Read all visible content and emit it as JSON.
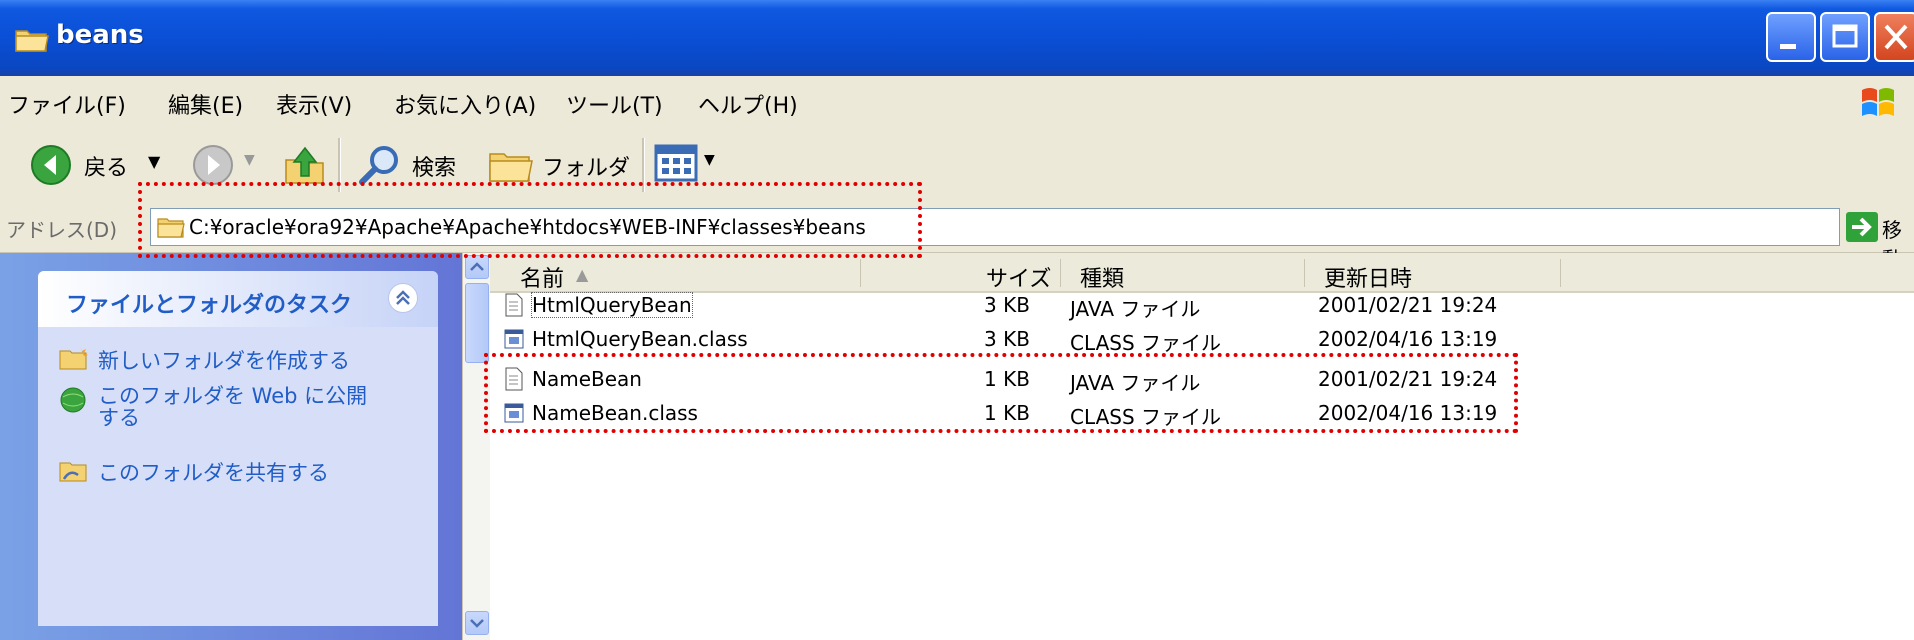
{
  "window": {
    "title": "beans"
  },
  "menu": [
    "ファイル(F)",
    "編集(E)",
    "表示(V)",
    "お気に入り(A)",
    "ツール(T)",
    "ヘルプ(H)"
  ],
  "toolbar": {
    "back": "戻る",
    "search": "検索",
    "folders": "フォルダ"
  },
  "address": {
    "label": "アドレス(D)",
    "path": "C:¥oracle¥ora92¥Apache¥Apache¥htdocs¥WEB-INF¥classes¥beans",
    "go": "移動"
  },
  "taskpane": {
    "title": "ファイルとフォルダのタスク",
    "tasks": [
      "新しいフォルダを作成する",
      "このフォルダを Web に公開する",
      "このフォルダを共有する"
    ]
  },
  "columns": {
    "name": "名前",
    "size": "サイズ",
    "type": "種類",
    "modified": "更新日時"
  },
  "files": [
    {
      "name": "HtmlQueryBean",
      "size": "3 KB",
      "type": "JAVA ファイル",
      "modified": "2001/02/21 19:24"
    },
    {
      "name": "HtmlQueryBean.class",
      "size": "3 KB",
      "type": "CLASS ファイル",
      "modified": "2002/04/16 13:19"
    },
    {
      "name": "NameBean",
      "size": "1 KB",
      "type": "JAVA ファイル",
      "modified": "2001/02/21 19:24"
    },
    {
      "name": "NameBean.class",
      "size": "1 KB",
      "type": "CLASS ファイル",
      "modified": "2002/04/16 13:19"
    }
  ]
}
